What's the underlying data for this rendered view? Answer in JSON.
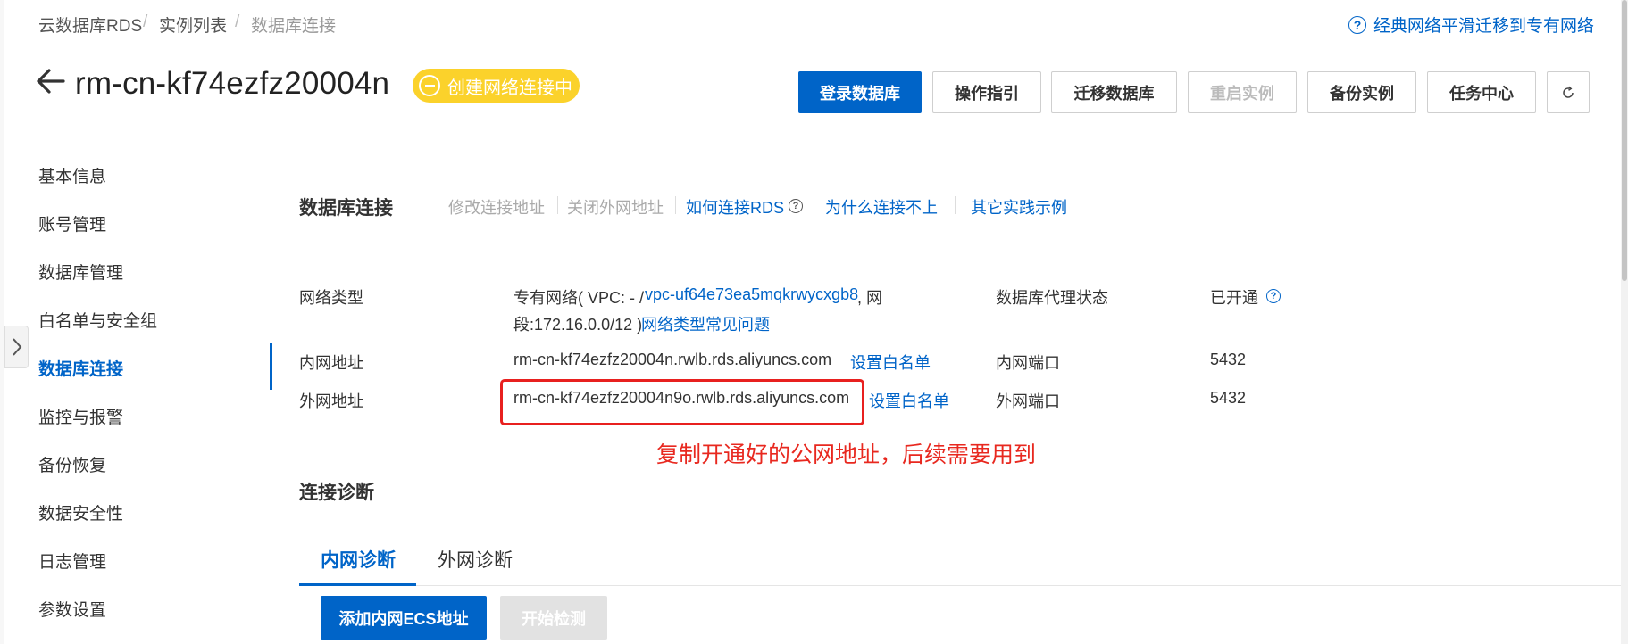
{
  "breadcrumb": {
    "items": [
      "云数据库RDS",
      "实例列表",
      "数据库连接"
    ],
    "separator": "/"
  },
  "help_link": {
    "icon": "question-circle-icon",
    "icon_glyph": "?",
    "label": "经典网络平滑迁移到专有网络"
  },
  "header": {
    "back_icon": "arrow-left-icon",
    "instance_id": "rm-cn-kf74ezfz20004n",
    "status": {
      "icon": "pending-icon",
      "label": "创建网络连接中",
      "color": "#fbd22b"
    }
  },
  "toolbar": {
    "login_db": "登录数据库",
    "guide": "操作指引",
    "migrate": "迁移数据库",
    "restart": "重启实例",
    "backup": "备份实例",
    "task_center": "任务中心",
    "refresh_icon": "refresh-icon"
  },
  "sidebar": {
    "collapse_icon": "chevron-right-icon",
    "items": [
      {
        "label": "基本信息"
      },
      {
        "label": "账号管理"
      },
      {
        "label": "数据库管理"
      },
      {
        "label": "白名单与安全组"
      },
      {
        "label": "数据库连接",
        "active": true
      },
      {
        "label": "监控与报警"
      },
      {
        "label": "备份恢复"
      },
      {
        "label": "数据安全性"
      },
      {
        "label": "日志管理"
      },
      {
        "label": "参数设置"
      }
    ]
  },
  "connection": {
    "title": "数据库连接",
    "actions": {
      "modify_address": "修改连接地址",
      "close_public": "关闭外网地址",
      "how_to_connect": "如何连接RDS",
      "why_fail": "为什么连接不上",
      "examples": "其它实践示例"
    },
    "network_type_label": "网络类型",
    "network_type_prefix": "专有网络( VPC: - /",
    "vpc_id": "vpc-uf64e73ea5mqkrwycxgb8",
    "network_type_suffix": ", 网",
    "cidr": "段:172.16.0.0/12 )",
    "network_faq": "网络类型常见问题",
    "proxy_status_label": "数据库代理状态",
    "proxy_status_value": "已开通",
    "internal_address_label": "内网地址",
    "internal_address": "rm-cn-kf74ezfz20004n.rwlb.rds.aliyuncs.com",
    "internal_whitelist": "设置白名单",
    "internal_port_label": "内网端口",
    "internal_port": "5432",
    "public_address_label": "外网地址",
    "public_address": "rm-cn-kf74ezfz20004n9o.rwlb.rds.aliyuncs.com",
    "public_whitelist": "设置白名单",
    "public_port_label": "外网端口",
    "public_port": "5432"
  },
  "annotation": {
    "text": "复制开通好的公网地址，后续需要用到",
    "color": "#e8281f"
  },
  "diagnosis": {
    "title": "连接诊断",
    "tabs": [
      {
        "label": "内网诊断",
        "active": true
      },
      {
        "label": "外网诊断"
      }
    ],
    "add_ecs": "添加内网ECS地址",
    "start_check": "开始检测"
  },
  "colors": {
    "primary": "#0064c8",
    "status_yellow": "#fbd22b",
    "annotation_red": "#e8201f"
  }
}
